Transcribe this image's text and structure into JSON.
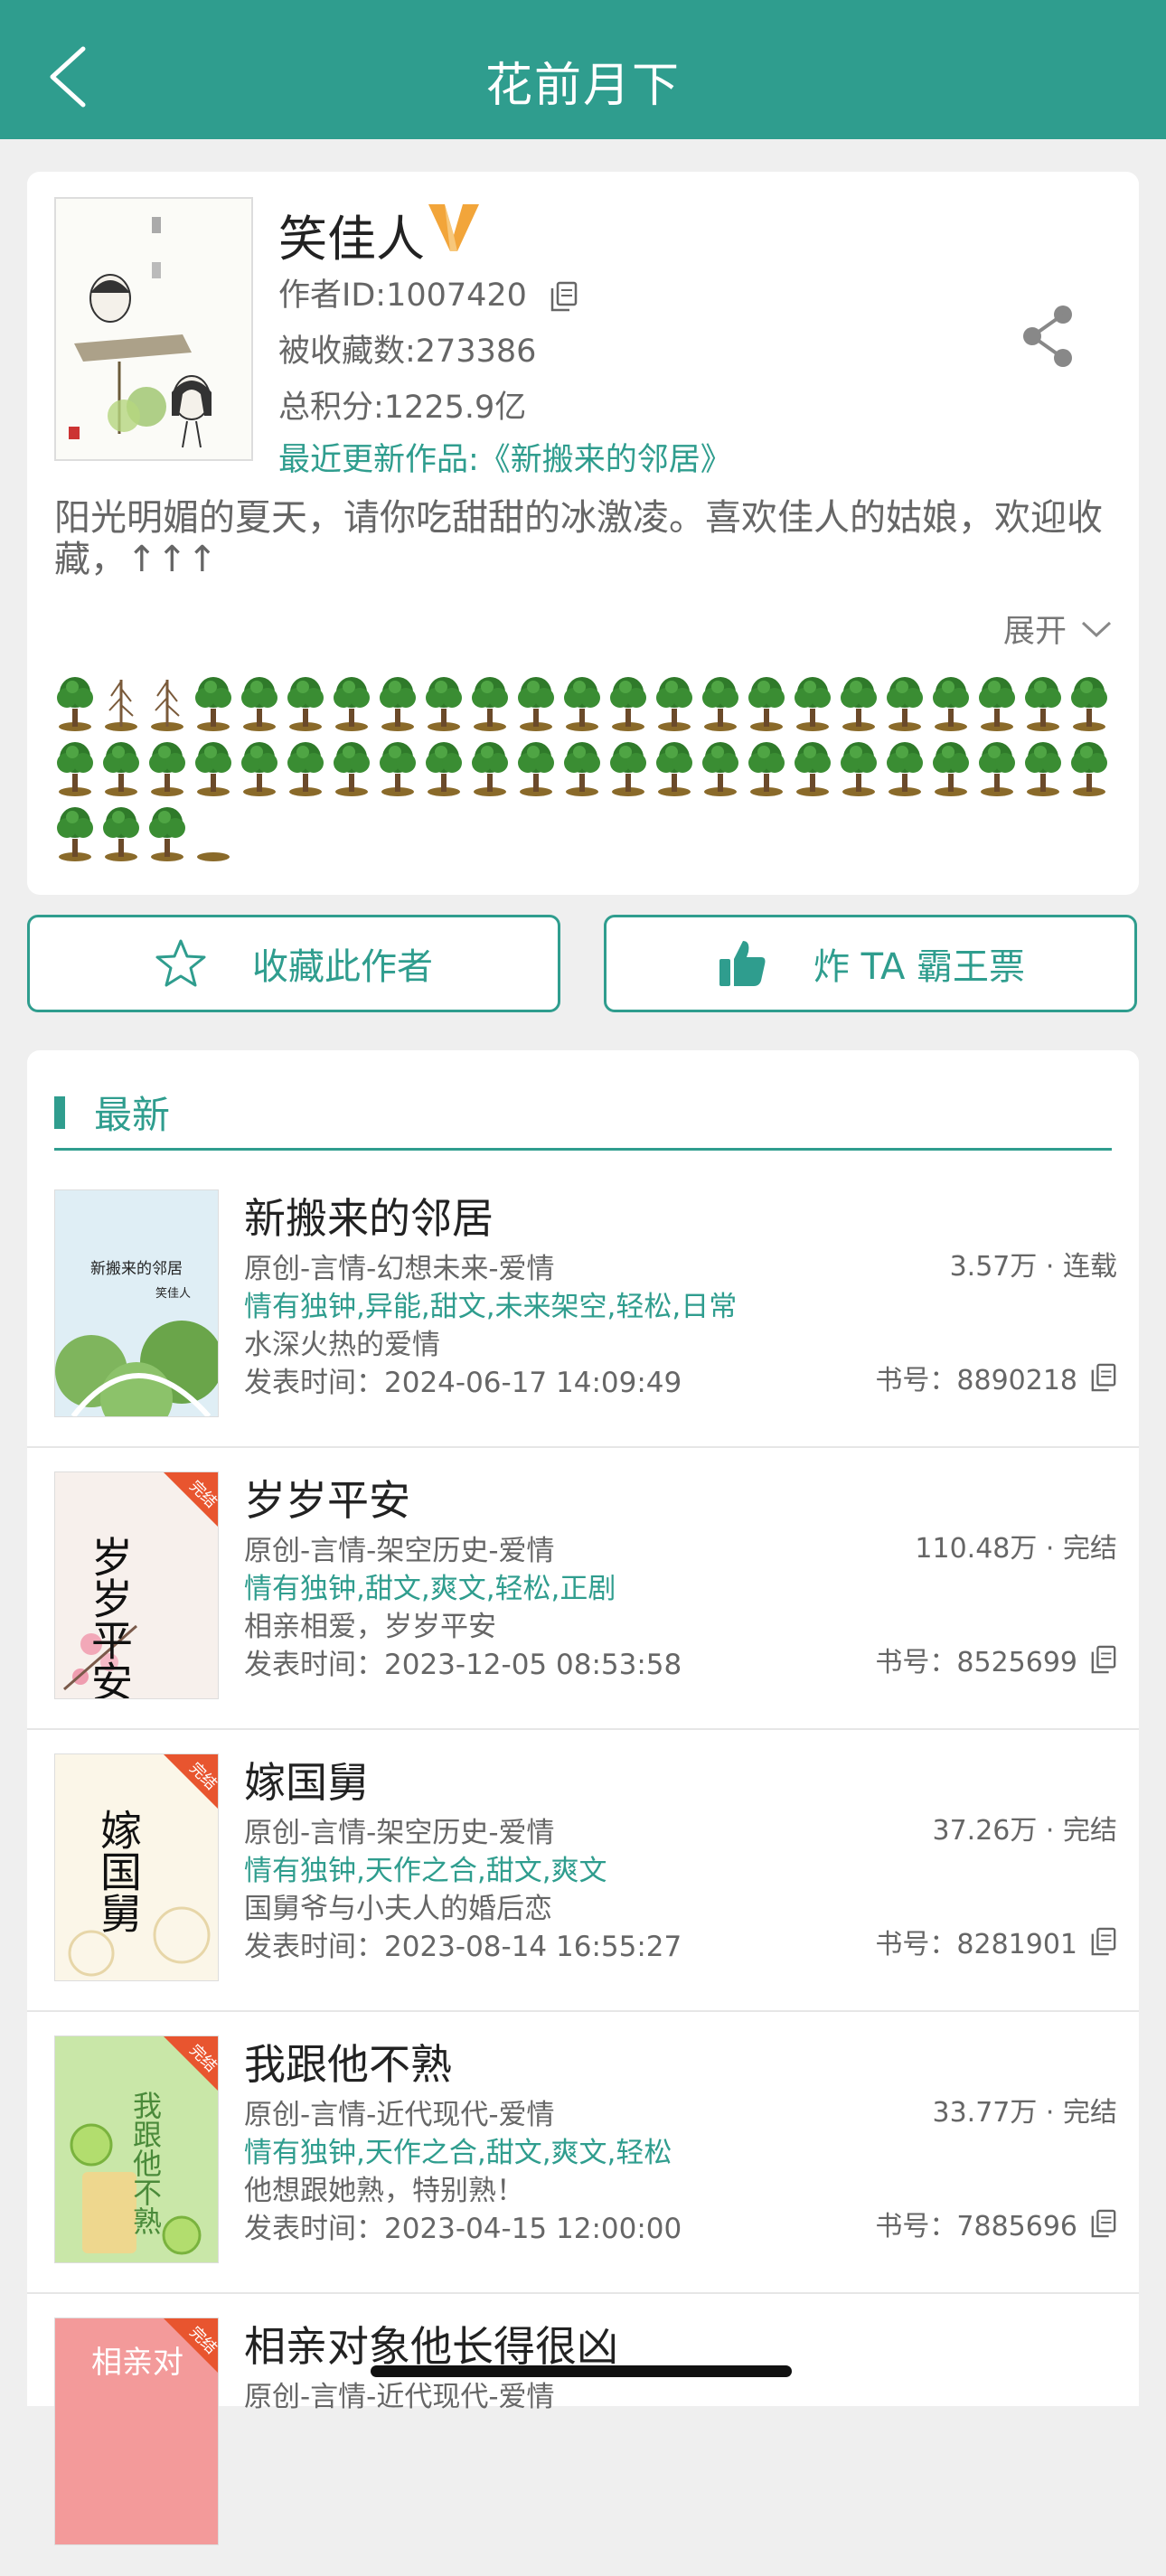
{
  "header": {
    "title": "花前月下",
    "back_icon": "chevron-left-icon"
  },
  "author": {
    "name": "笑佳人",
    "vip_icon": "vip-v-icon",
    "id_line": "作者ID:1007420",
    "favorites_line": "被收藏数:273386",
    "score_line": "总积分:1225.9亿",
    "latest_line": "最近更新作品:《新搬来的邻居》",
    "intro": "阳光明媚的夏天，请你吃甜甜的冰激凌。喜欢佳人的姑娘，欢迎收藏，↑↑↑",
    "expand_label": "展开",
    "share_icon": "share-icon"
  },
  "buttons": {
    "follow_label": "收藏此作者",
    "ticket_label": "炸 TA 霸王票"
  },
  "section": {
    "title": "最新"
  },
  "books": [
    {
      "title": "新搬来的邻居",
      "genre": "原创-言情-幻想未来-爱情",
      "tags": "情有独钟,异能,甜文,未来架空,轻松,日常",
      "desc": "水深火热的爱情",
      "date": "发表时间：2024-06-17 14:09:49",
      "stat": "3.57万 · 连载",
      "book_id": "书号：8890218",
      "cover_title": "新搬来的邻居",
      "cover_author": "笑佳人",
      "badge": ""
    },
    {
      "title": "岁岁平安",
      "genre": "原创-言情-架空历史-爱情",
      "tags": "情有独钟,甜文,爽文,轻松,正剧",
      "desc": "相亲相爱，岁岁平安",
      "date": "发表时间：2023-12-05 08:53:58",
      "stat": "110.48万 · 完结",
      "book_id": "书号：8525699",
      "cover_title": "岁岁平安",
      "cover_author": "",
      "badge": "完结"
    },
    {
      "title": "嫁国舅",
      "genre": "原创-言情-架空历史-爱情",
      "tags": "情有独钟,天作之合,甜文,爽文",
      "desc": "国舅爷与小夫人的婚后恋",
      "date": "发表时间：2023-08-14 16:55:27",
      "stat": "37.26万 · 完结",
      "book_id": "书号：8281901",
      "cover_title": "嫁国舅",
      "cover_author": "",
      "badge": "完结"
    },
    {
      "title": "我跟他不熟",
      "genre": "原创-言情-近代现代-爱情",
      "tags": "情有独钟,天作之合,甜文,爽文,轻松",
      "desc": "他想跟她熟，特别熟！",
      "date": "发表时间：2023-04-15 12:00:00",
      "stat": "33.77万 · 完结",
      "book_id": "书号：7885696",
      "cover_title": "我跟他不熟",
      "cover_author": "",
      "badge": "完结"
    },
    {
      "title": "相亲对象他长得很凶",
      "genre": "原创-言情-近代现代-爱情",
      "tags": "",
      "desc": "",
      "date": "",
      "stat": "",
      "book_id": "",
      "cover_title": "相亲对",
      "cover_author": "",
      "badge": "完结"
    }
  ],
  "colors": {
    "accent": "#2f9d8e",
    "header_bg": "#2f9d8e",
    "vip": "#f2a53a",
    "badge": "#e8552f"
  }
}
